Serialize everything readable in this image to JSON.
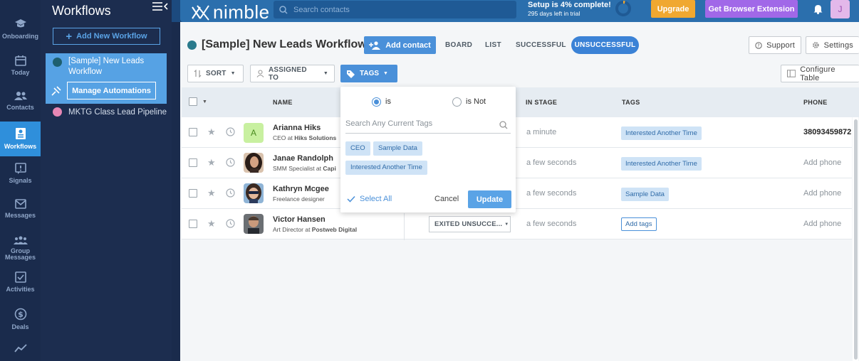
{
  "rail": {
    "items": [
      {
        "label": "Onboarding",
        "icon": "mortarboard-icon"
      },
      {
        "label": "Today",
        "icon": "calendar-icon"
      },
      {
        "label": "Contacts",
        "icon": "contacts-icon"
      },
      {
        "label": "Workflows",
        "icon": "workflows-icon",
        "active": true
      },
      {
        "label": "Signals",
        "icon": "signals-icon"
      },
      {
        "label": "Messages",
        "icon": "envelope-icon"
      },
      {
        "label_line1": "Group",
        "label_line2": "Messages",
        "icon": "group-messages-icon"
      },
      {
        "label": "Activities",
        "icon": "activities-icon"
      },
      {
        "label": "Deals",
        "icon": "dollar-icon"
      }
    ]
  },
  "panel": {
    "title": "Workflows",
    "add_workflow": "Add New Workflow",
    "workflows": [
      {
        "name": "[Sample] New Leads Workflow",
        "color": "#1e5f6f"
      },
      {
        "name": "MKTG Class Lead Pipeline",
        "color": "#e687b5"
      }
    ],
    "manage_automations": "Manage Automations"
  },
  "topbar": {
    "logo": "nimble",
    "search_placeholder": "Search contacts",
    "setup_title": "Setup is 4% complete!",
    "setup_sub": "295 days left in trial",
    "setup_progress": 0.04,
    "upgrade": "Upgrade",
    "extension": "Get Browser Extension",
    "avatar_letter": "J"
  },
  "workflow": {
    "title": "[Sample] New Leads Workflow",
    "add_contact": "Add contact",
    "tabs": [
      "BOARD",
      "LIST",
      "SUCCESSFUL",
      "UNSUCCESSFUL"
    ],
    "active_tab": "UNSUCCESSFUL",
    "support": "Support",
    "settings": "Settings",
    "configure_table": "Configure Table",
    "toolbar": {
      "sort": "SORT",
      "assigned_to": "ASSIGNED TO",
      "tags": "TAGS"
    }
  },
  "table": {
    "headers": {
      "name": "NAME",
      "in_stage": "IN STAGE",
      "tags": "TAGS",
      "phone": "PHONE"
    },
    "rows": [
      {
        "name": "Arianna Hiks",
        "role": "CEO at ",
        "company": "Hiks Solutions",
        "avatar": "A",
        "stage": "",
        "time": "a minute",
        "tags": [
          "Interested Another Time"
        ],
        "phone": "38093459872"
      },
      {
        "name": "Janae Randolph",
        "role": "SMM Specialist at ",
        "company": "Capi",
        "avatar": "photo",
        "stage": "",
        "time": "a few seconds",
        "tags": [
          "Interested Another Time"
        ],
        "phone": "Add phone"
      },
      {
        "name": "Kathryn Mcgee",
        "role": "Freelance designer",
        "company": "",
        "avatar": "photo",
        "stage": "",
        "time": "a few seconds",
        "tags": [
          "Sample Data"
        ],
        "phone": "Add phone"
      },
      {
        "name": "Victor Hansen",
        "role": "Art Director at ",
        "company": "Postweb Digital",
        "avatar": "photo",
        "stage": "EXITED UNSUCCE...",
        "time": "a few seconds",
        "tags": [],
        "add_tags": "Add tags",
        "phone": "Add phone"
      }
    ]
  },
  "tags_dropdown": {
    "option_is": "is",
    "option_is_not": "is Not",
    "selected": "is",
    "search_placeholder": "Search Any Current Tags",
    "chips": [
      "CEO",
      "Sample Data",
      "Interested Another Time"
    ],
    "select_all": "Select All",
    "cancel": "Cancel",
    "update": "Update"
  }
}
